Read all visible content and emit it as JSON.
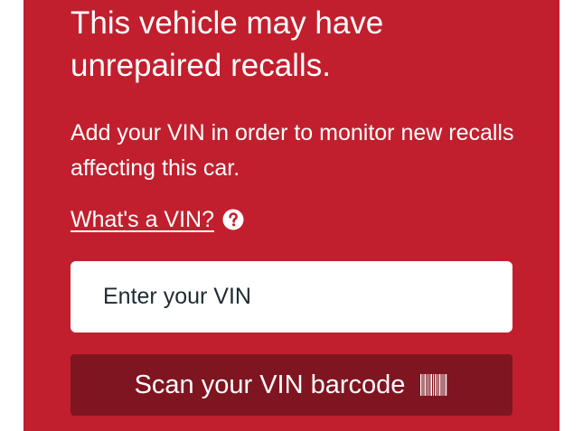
{
  "alert": {
    "headline": "This vehicle may have unrepaired recalls.",
    "description": "Add your VIN in order to monitor new recalls affecting this car.",
    "help_link_label": "What's a VIN?",
    "help_icon": "question-circle-icon"
  },
  "vin_form": {
    "input_placeholder": "Enter your VIN",
    "input_value": "",
    "scan_button_label": "Scan your VIN barcode",
    "scan_icon": "barcode-icon"
  },
  "colors": {
    "panel_background": "#c11f2e",
    "scan_button_background": "#7f1520",
    "input_background": "#ffffff",
    "text_primary": "#ffffff",
    "input_text": "#1e2b33"
  }
}
